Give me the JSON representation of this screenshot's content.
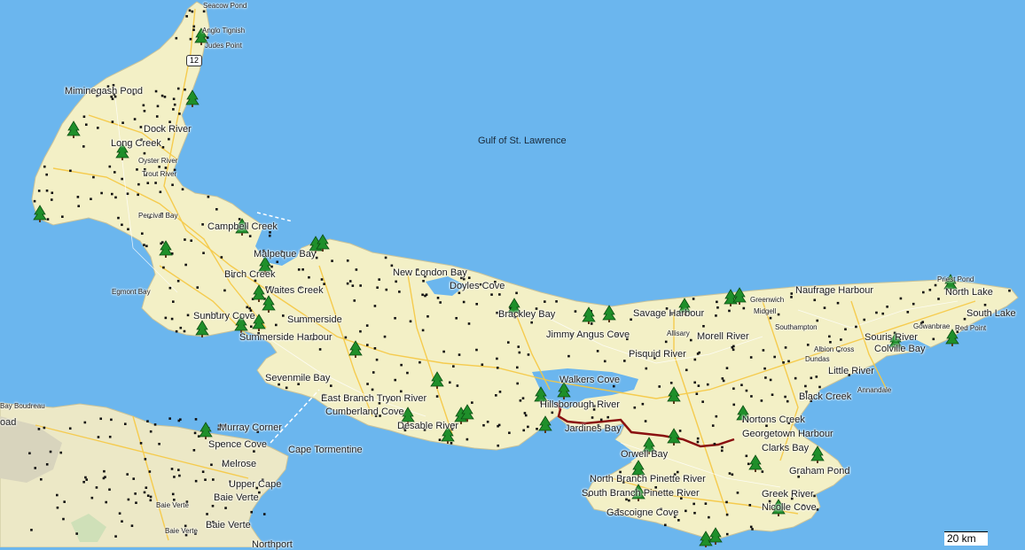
{
  "map": {
    "water_label": "Gulf of St. Lawrence",
    "scale_label": "20 km",
    "route_shield": "12",
    "places": [
      {
        "name": "Seacow Pond",
        "size": "sm"
      },
      {
        "name": "Anglo Tignish",
        "size": "sm"
      },
      {
        "name": "Judes Point",
        "size": "sm"
      },
      {
        "name": "Miminegash Pond",
        "size": "md"
      },
      {
        "name": "Dock River",
        "size": "md"
      },
      {
        "name": "Long Creek",
        "size": "md"
      },
      {
        "name": "Oyster River",
        "size": "sm"
      },
      {
        "name": "Trout River",
        "size": "sm"
      },
      {
        "name": "Percival Bay",
        "size": "sm"
      },
      {
        "name": "Campbell Creek",
        "size": "md"
      },
      {
        "name": "Malpeque Bay",
        "size": "md"
      },
      {
        "name": "Birch Creek",
        "size": "md"
      },
      {
        "name": "Egmont Bay",
        "size": "sm"
      },
      {
        "name": "Waites Creek",
        "size": "md"
      },
      {
        "name": "Sunbury Cove",
        "size": "md"
      },
      {
        "name": "Summerside",
        "size": "md"
      },
      {
        "name": "Summerside Harbour",
        "size": "md"
      },
      {
        "name": "New London Bay",
        "size": "md"
      },
      {
        "name": "Doyles Cove",
        "size": "md"
      },
      {
        "name": "Brackley Bay",
        "size": "md"
      },
      {
        "name": "Savage Harbour",
        "size": "md"
      },
      {
        "name": "Jimmy Angus Cove",
        "size": "md"
      },
      {
        "name": "Allisary",
        "size": "sm"
      },
      {
        "name": "Morell River",
        "size": "md"
      },
      {
        "name": "Pisquid River",
        "size": "md"
      },
      {
        "name": "Greenwich",
        "size": "sm"
      },
      {
        "name": "Midgell",
        "size": "sm"
      },
      {
        "name": "Naufrage Harbour",
        "size": "md"
      },
      {
        "name": "Priest Pond",
        "size": "sm"
      },
      {
        "name": "North Lake",
        "size": "md"
      },
      {
        "name": "South Lake",
        "size": "md"
      },
      {
        "name": "Southampton",
        "size": "sm"
      },
      {
        "name": "Gowanbrae",
        "size": "sm"
      },
      {
        "name": "Souris River",
        "size": "md"
      },
      {
        "name": "Red Point",
        "size": "sm"
      },
      {
        "name": "Colville Bay",
        "size": "md"
      },
      {
        "name": "Albion Cross",
        "size": "sm"
      },
      {
        "name": "Dundas",
        "size": "sm"
      },
      {
        "name": "Little River",
        "size": "md"
      },
      {
        "name": "Annandale",
        "size": "sm"
      },
      {
        "name": "Black Creek",
        "size": "md"
      },
      {
        "name": "Sevenmile Bay",
        "size": "md"
      },
      {
        "name": "East Branch Tryon River",
        "size": "md"
      },
      {
        "name": "Cumberland Cove",
        "size": "md"
      },
      {
        "name": "Desable River",
        "size": "md"
      },
      {
        "name": "Walkers Cove",
        "size": "md"
      },
      {
        "name": "Hillsborough River",
        "size": "md"
      },
      {
        "name": "Jardines Bay",
        "size": "md"
      },
      {
        "name": "Nortons Creek",
        "size": "md"
      },
      {
        "name": "Georgetown Harbour",
        "size": "md"
      },
      {
        "name": "Clarks Bay",
        "size": "md"
      },
      {
        "name": "Orwell Bay",
        "size": "md"
      },
      {
        "name": "Graham Pond",
        "size": "md"
      },
      {
        "name": "North Branch Pinette River",
        "size": "md"
      },
      {
        "name": "South Branch Pinette River",
        "size": "md"
      },
      {
        "name": "Greek River",
        "size": "md"
      },
      {
        "name": "Nicolle Cove",
        "size": "md"
      },
      {
        "name": "Gascoigne Cove",
        "size": "md"
      },
      {
        "name": "Murray Corner",
        "size": "md"
      },
      {
        "name": "Spence Cove",
        "size": "md"
      },
      {
        "name": "Cape Tormentine",
        "size": "md"
      },
      {
        "name": "Melrose",
        "size": "md"
      },
      {
        "name": "Upper Cape",
        "size": "md"
      },
      {
        "name": "Baie Verte",
        "size": "md"
      },
      {
        "name": "Baie Verte",
        "size": "sm"
      },
      {
        "name": "Baie Verte",
        "size": "md"
      },
      {
        "name": "Baie Verte",
        "size": "sm"
      },
      {
        "name": "Northport",
        "size": "md"
      },
      {
        "name": "Bay Boudreau",
        "size": "sm"
      },
      {
        "name": "oad",
        "size": "md"
      }
    ]
  }
}
